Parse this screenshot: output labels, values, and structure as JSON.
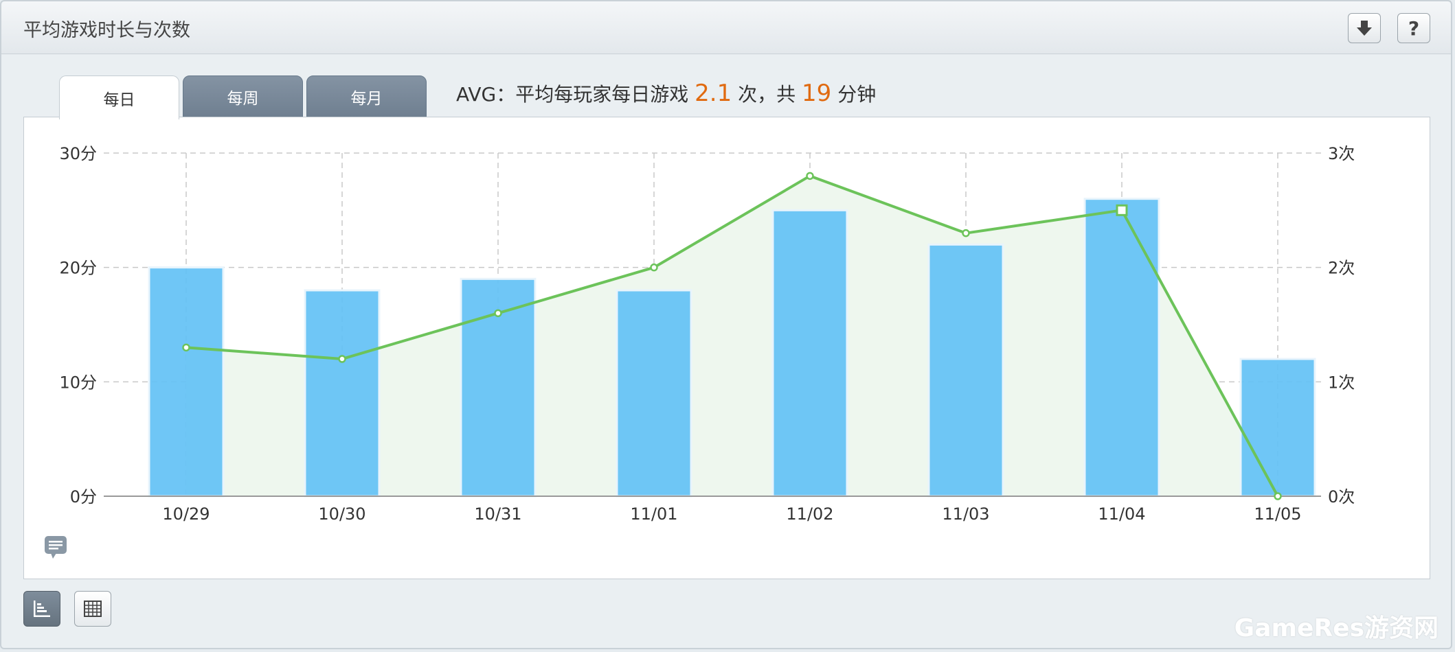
{
  "panel": {
    "title": "平均游戏时长与次数",
    "buttons": {
      "download": "download-icon",
      "help": "?"
    }
  },
  "tabs": [
    {
      "label": "每日",
      "active": true
    },
    {
      "label": "每周",
      "active": false
    },
    {
      "label": "每月",
      "active": false
    }
  ],
  "avg": {
    "prefix": "AVG：平均每玩家每日游戏",
    "count_value": "2.1",
    "count_unit": "次，共",
    "minutes_value": "19",
    "minutes_unit": "分钟"
  },
  "chart_data": {
    "type": "bar",
    "categories": [
      "10/29",
      "10/30",
      "10/31",
      "11/01",
      "11/02",
      "11/03",
      "11/04",
      "11/05"
    ],
    "series": [
      {
        "type": "bar",
        "axis": "left",
        "values": [
          20,
          18,
          19,
          18,
          25,
          22,
          26,
          12
        ]
      },
      {
        "type": "line",
        "axis": "right",
        "values": [
          1.3,
          1.2,
          1.6,
          2.0,
          2.8,
          2.3,
          2.5,
          0
        ]
      }
    ],
    "y_left": {
      "range": [
        0,
        30
      ],
      "ticks": [
        "0分",
        "10分",
        "20分",
        "30分"
      ]
    },
    "y_right": {
      "range": [
        0,
        3
      ],
      "ticks": [
        "0次",
        "1次",
        "2次",
        "3次"
      ]
    },
    "highlighted_point": "11/04",
    "grid": true,
    "colors": {
      "bar": "#63c1f5",
      "line": "#6cc35a",
      "area": "#eef7ee"
    }
  },
  "view_toggle": {
    "chart_icon": "bar-chart-icon",
    "table_icon": "table-grid-icon"
  },
  "watermark": "GameRes游资网"
}
